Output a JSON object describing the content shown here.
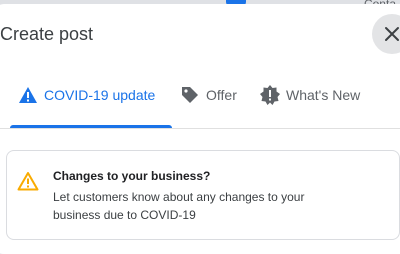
{
  "background": {
    "partial_text": "Conta"
  },
  "dialog": {
    "title": "Create post",
    "close_label": "Close"
  },
  "tabs": [
    {
      "label": "COVID-19 update",
      "icon": "warning-icon",
      "active": true
    },
    {
      "label": "Offer",
      "icon": "tag-icon",
      "active": false
    },
    {
      "label": "What's New",
      "icon": "new-badge-icon",
      "active": false
    }
  ],
  "notice": {
    "icon": "warning-outline-icon",
    "heading": "Changes to your business?",
    "body": "Let customers know about any changes to your business due to COVID-19"
  },
  "colors": {
    "accent": "#1a73e8",
    "warning": "#f9ab00",
    "text": "#3c4043"
  }
}
